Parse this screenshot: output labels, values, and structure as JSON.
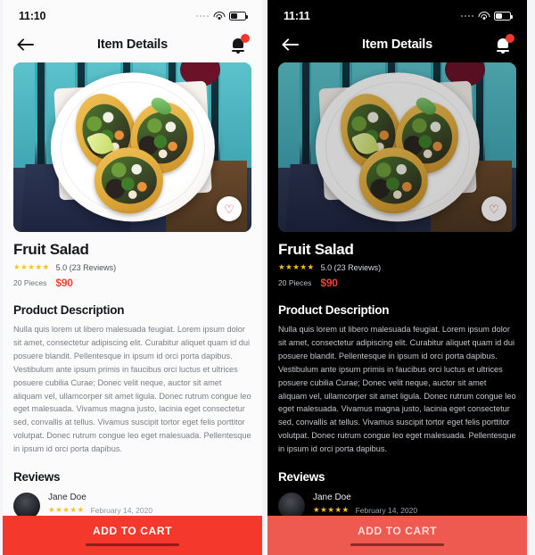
{
  "panels": [
    {
      "theme": "light",
      "statusbar": {
        "time": "11:10",
        "wifi_icon": "wifi-icon",
        "battery_icon": "battery-icon",
        "signal_icon": "signal-dots-icon"
      },
      "navbar": {
        "back_icon": "back-arrow-icon",
        "title": "Item Details",
        "bell_icon": "bell-icon",
        "badge_count": ""
      }
    },
    {
      "theme": "dark",
      "statusbar": {
        "time": "11:11",
        "wifi_icon": "wifi-icon",
        "battery_icon": "battery-icon",
        "signal_icon": "signal-dots-icon"
      },
      "navbar": {
        "back_icon": "back-arrow-icon",
        "title": "Item Details",
        "bell_icon": "bell-icon",
        "badge_count": ""
      }
    }
  ],
  "product": {
    "hero_image_alt": "three tacos on a white plate on a turquoise picnic table",
    "favorite_icon": "heart-outline-icon",
    "title": "Fruit Salad",
    "stars": "★★★★★",
    "rating_text": "5.0 (23 Reviews)",
    "pieces": "20 Pieces",
    "price": "$90"
  },
  "description": {
    "heading": "Product Description",
    "body": "Nulla quis lorem ut libero malesuada feugiat. Lorem ipsum dolor sit amet, consectetur adipiscing elit. Curabitur aliquet quam id dui posuere blandit. Pellentesque in ipsum id orci porta dapibus. Vestibulum ante ipsum primis in faucibus orci luctus et ultrices posuere cubilia Curae; Donec velit neque, auctor sit amet aliquam vel, ullamcorper sit amet ligula. Donec rutrum congue leo eget malesuada. Vivamus magna justo, lacinia eget consectetur sed, convallis at tellus. Vivamus suscipit tortor eget felis porttitor volutpat. Donec rutrum congue leo eget malesuada. Pellentesque in ipsum id orci porta dapibus."
  },
  "reviews": {
    "heading": "Reviews",
    "items": [
      {
        "avatar": "user-avatar",
        "name": "Jane Doe",
        "stars": "★★★★★",
        "date": "February 14, 2020"
      }
    ]
  },
  "cta": {
    "label": "ADD TO CART",
    "home_indicator": "home-indicator"
  },
  "colors": {
    "accent_red": "#f4392c",
    "accent_red_dark": "#ee5a4f",
    "price_red": "#f04438",
    "star_gold": "#fbbf24",
    "light_bg": "#fbfbfc",
    "dark_bg": "#000000"
  }
}
